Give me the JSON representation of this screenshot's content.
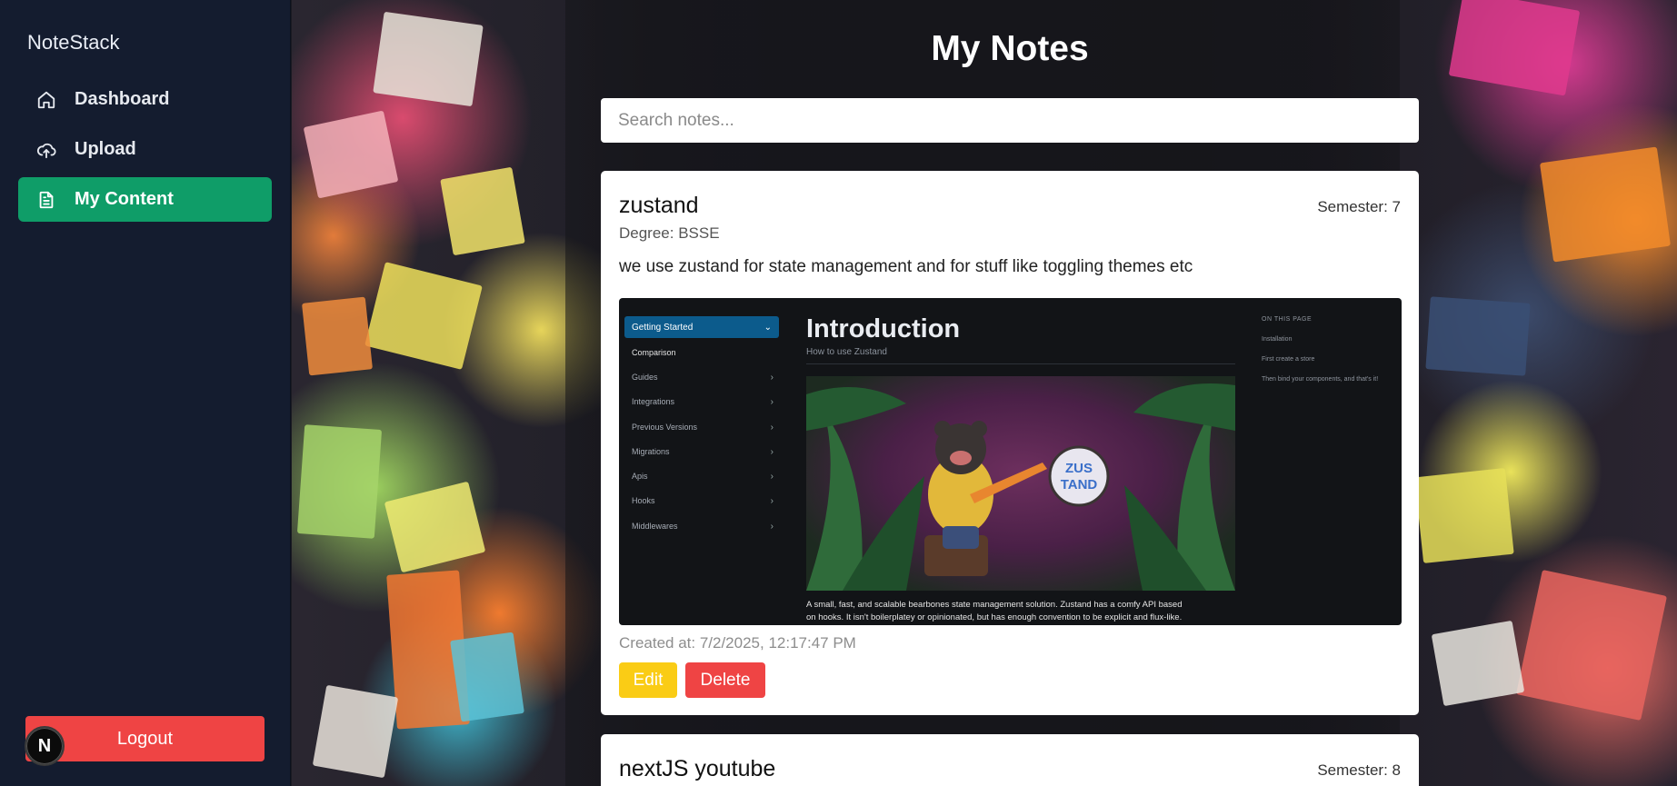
{
  "sidebar": {
    "brand": "NoteStack",
    "items": [
      {
        "label": "Dashboard",
        "icon": "home-icon",
        "active": false
      },
      {
        "label": "Upload",
        "icon": "cloud-upload-icon",
        "active": false
      },
      {
        "label": "My Content",
        "icon": "document-icon",
        "active": true
      }
    ],
    "logout_label": "Logout",
    "dev_badge": "N"
  },
  "main": {
    "title": "My Notes",
    "search": {
      "placeholder": "Search notes...",
      "value": ""
    },
    "notes": [
      {
        "title": "zustand",
        "semester": "Semester: 7",
        "degree": "Degree: BSSE",
        "description": "we use zustand for state management and for stuff like toggling themes etc",
        "created": "Created at: 7/2/2025, 12:17:47 PM",
        "edit_label": "Edit",
        "delete_label": "Delete",
        "image": {
          "nav_selected": "Getting Started",
          "nav_items": [
            "Comparison",
            "Guides",
            "Integrations",
            "Previous Versions",
            "Migrations",
            "Apis",
            "Hooks",
            "Middlewares"
          ],
          "heading": "Introduction",
          "subheading": "How to use Zustand",
          "badge": "ZUS TAND",
          "body_line1": "A small, fast, and scalable bearbones state management solution. Zustand has a comfy API based",
          "body_line2": "on hooks. It isn't boilerplatey or opinionated, but has enough convention to be explicit and flux-like.",
          "toc_heading": "ON THIS PAGE",
          "toc_items": [
            "Installation",
            "First create a store",
            "Then bind your components, and that's it!"
          ]
        }
      },
      {
        "title": "nextJS youtube",
        "semester": "Semester: 8"
      }
    ]
  },
  "colors": {
    "sidebar_bg": "#141c2f",
    "active_nav": "#0f9d68",
    "logout": "#ef4444",
    "edit": "#facc15",
    "delete": "#ef4444"
  }
}
